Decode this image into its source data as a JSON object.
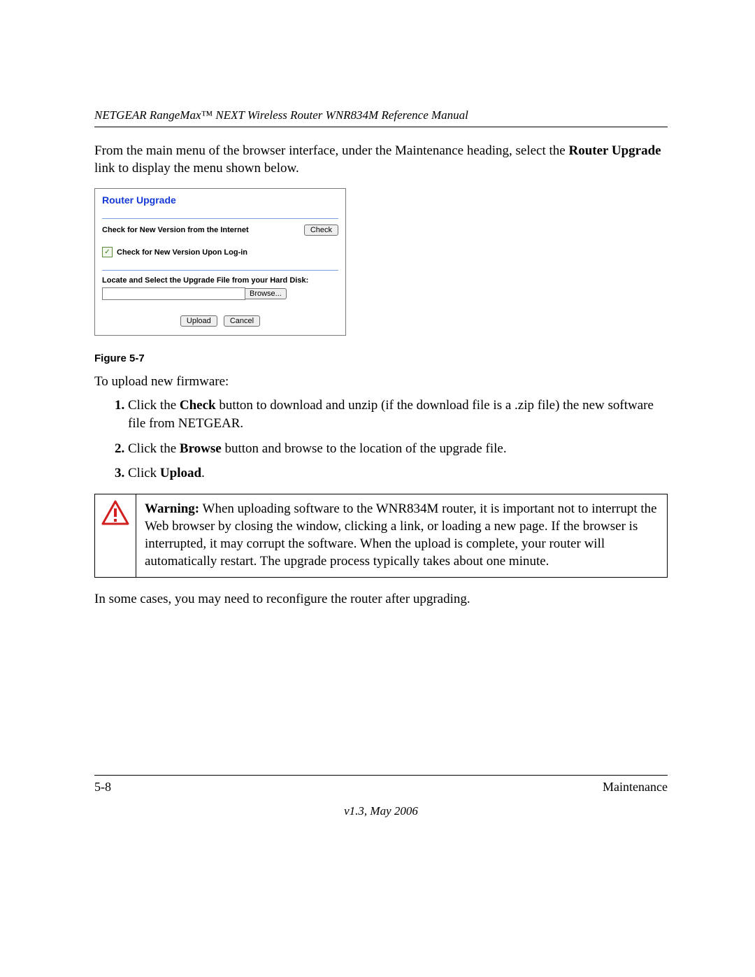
{
  "header": {
    "running_title": "NETGEAR RangeMax™ NEXT Wireless Router WNR834M Reference Manual"
  },
  "intro": {
    "pre": "From the main menu of the browser interface, under the Maintenance heading, select the ",
    "bold1": "Router Upgrade",
    "post": " link to display the menu shown below."
  },
  "router_upgrade": {
    "title": "Router Upgrade",
    "check_label": "Check for New Version from the Internet",
    "check_button": "Check",
    "checkbox_checked": "✓",
    "login_check_label": "Check for New Version Upon Log-in",
    "locate_label": "Locate and Select the Upgrade File from your Hard Disk:",
    "browse_button": "Browse...",
    "upload_button": "Upload",
    "cancel_button": "Cancel"
  },
  "figure_caption": "Figure 5-7",
  "upload_intro": "To upload new firmware:",
  "steps": {
    "s1_a": "Click the ",
    "s1_b": "Check",
    "s1_c": " button to download and unzip (if the download file is a .zip file) the new software file from NETGEAR.",
    "s2_a": "Click the ",
    "s2_b": "Browse",
    "s2_c": " button and browse to the location of the upgrade file.",
    "s3_a": "Click ",
    "s3_b": "Upload",
    "s3_c": "."
  },
  "warning": {
    "label": "Warning:",
    "text": " When uploading software to the WNR834M router, it is important not to interrupt the Web browser by closing the window, clicking a link, or loading a new page. If the browser is interrupted, it may corrupt the software. When the upload is complete, your router will automatically restart. The upgrade process typically takes about one minute."
  },
  "after_warning": "In some cases, you may need to reconfigure the router after upgrading.",
  "footer": {
    "page_num": "5-8",
    "section": "Maintenance",
    "version": "v1.3, May 2006"
  }
}
